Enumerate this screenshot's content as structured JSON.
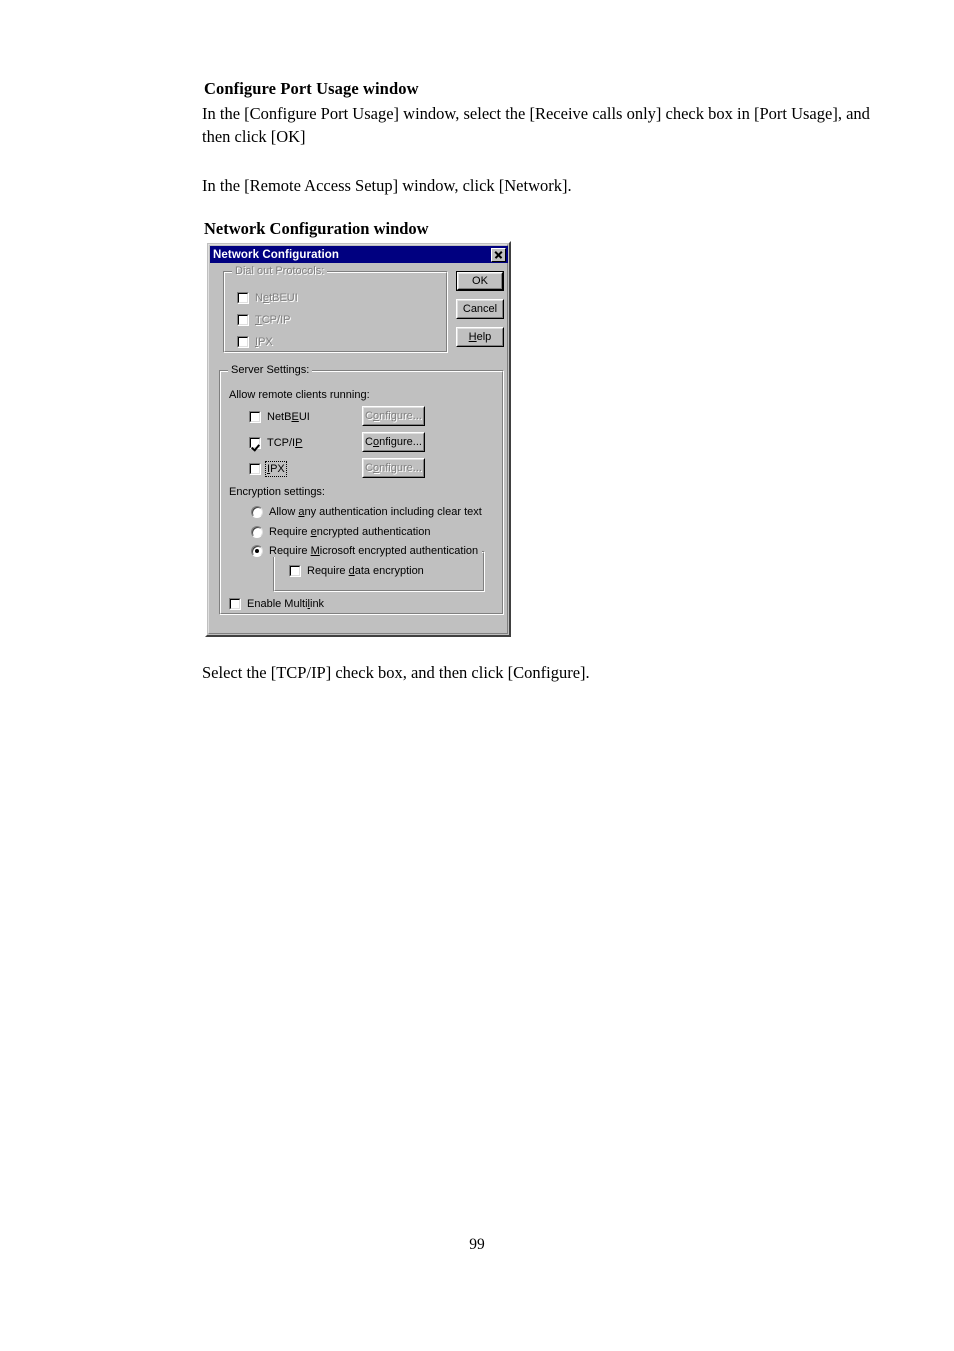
{
  "document": {
    "section1_heading": "Configure Port Usage window",
    "section1_para": "In the [Configure Port Usage] window, select the [Receive calls only] check box in [Port Usage], and then click [OK]",
    "section1_para2": "In the [Remote Access Setup] window, click [Network].",
    "section2_heading": "Network Configuration window",
    "closing_para": "Select the [TCP/IP] check box, and then click [Configure].",
    "page_number": "99"
  },
  "dialog": {
    "title": "Network Configuration",
    "close_icon": "close-icon",
    "buttons": {
      "ok": "OK",
      "cancel": "Cancel",
      "help_pre": "H",
      "help_post": "elp"
    },
    "dial_out": {
      "legend": "Dial out Protocols:",
      "items": [
        {
          "pre": "N",
          "accel": "e",
          "post": "tBEUI",
          "checked": false,
          "disabled": true
        },
        {
          "pre": "",
          "accel": "T",
          "post": "CP/IP",
          "checked": false,
          "disabled": true
        },
        {
          "pre": "",
          "accel": "I",
          "post": "PX",
          "checked": false,
          "disabled": true
        }
      ]
    },
    "server_settings": {
      "legend": "Server Settings:",
      "subtitle": "Allow remote clients running:",
      "protocols": [
        {
          "pre": "NetB",
          "accel": "E",
          "post": "UI",
          "checked": false,
          "focused": false,
          "button_pre": "C",
          "button_accel": "o",
          "button_post": "nfigure...",
          "button_disabled": true
        },
        {
          "pre": "TCP/I",
          "accel": "P",
          "post": "",
          "checked": true,
          "focused": false,
          "button_pre": "C",
          "button_accel": "o",
          "button_post": "nfigure...",
          "button_disabled": false
        },
        {
          "pre": "I",
          "accel": "P",
          "post": "X",
          "checked": false,
          "focused": true,
          "button_pre": "C",
          "button_accel": "o",
          "button_post": "nfigure...",
          "button_disabled": true
        }
      ],
      "encryption": {
        "subtitle": "Encryption settings:",
        "options": [
          {
            "pre": "Allow ",
            "accel": "a",
            "post": "ny authentication including clear text",
            "selected": false
          },
          {
            "pre": "Require ",
            "accel": "e",
            "post": "ncrypted authentication",
            "selected": false
          },
          {
            "pre": "Require ",
            "accel": "M",
            "post": "icrosoft encrypted authentication",
            "selected": true
          }
        ],
        "data_encryption": {
          "pre": "Require ",
          "accel": "d",
          "post": "ata encryption",
          "checked": false
        }
      },
      "multilink": {
        "pre": "Enable Multi",
        "accel": "l",
        "post": "ink",
        "checked": false
      }
    }
  },
  "colors": {
    "dialog_face": "#c0c0c0",
    "titlebar": "#000080",
    "titlebar_text": "#ffffff",
    "disabled_text": "#808080",
    "page_bg": "#ffffff"
  }
}
